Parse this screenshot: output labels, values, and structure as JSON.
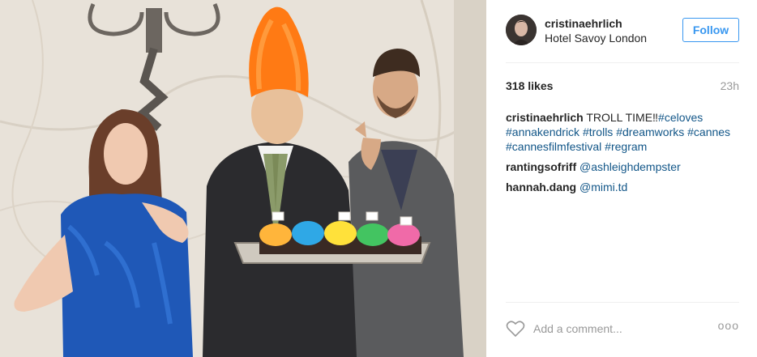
{
  "post": {
    "username": "cristinaehrlich",
    "location": "Hotel Savoy London",
    "follow_label": "Follow",
    "likes": "318 likes",
    "time": "23h",
    "caption": {
      "user": "cristinaehrlich",
      "text_prefix": "TROLL TIME‼",
      "tags": [
        "#celoves",
        "#annakendrick",
        "#trolls",
        "#dreamworks",
        "#cannes",
        "#cannesfilmfestival",
        "#regram"
      ]
    },
    "comments": [
      {
        "user": "rantingsofriff",
        "mention": "@ashleighdempster"
      },
      {
        "user": "hannah.dang",
        "mention": "@mimi.td"
      }
    ],
    "add_comment_placeholder": "Add a comment...",
    "more_label": "ooo"
  },
  "icons": {
    "heart": "heart-outline-icon",
    "more": "more-options-icon"
  },
  "colors": {
    "accent": "#3897f0",
    "link": "#125688",
    "text": "#262626",
    "muted": "#999999"
  }
}
